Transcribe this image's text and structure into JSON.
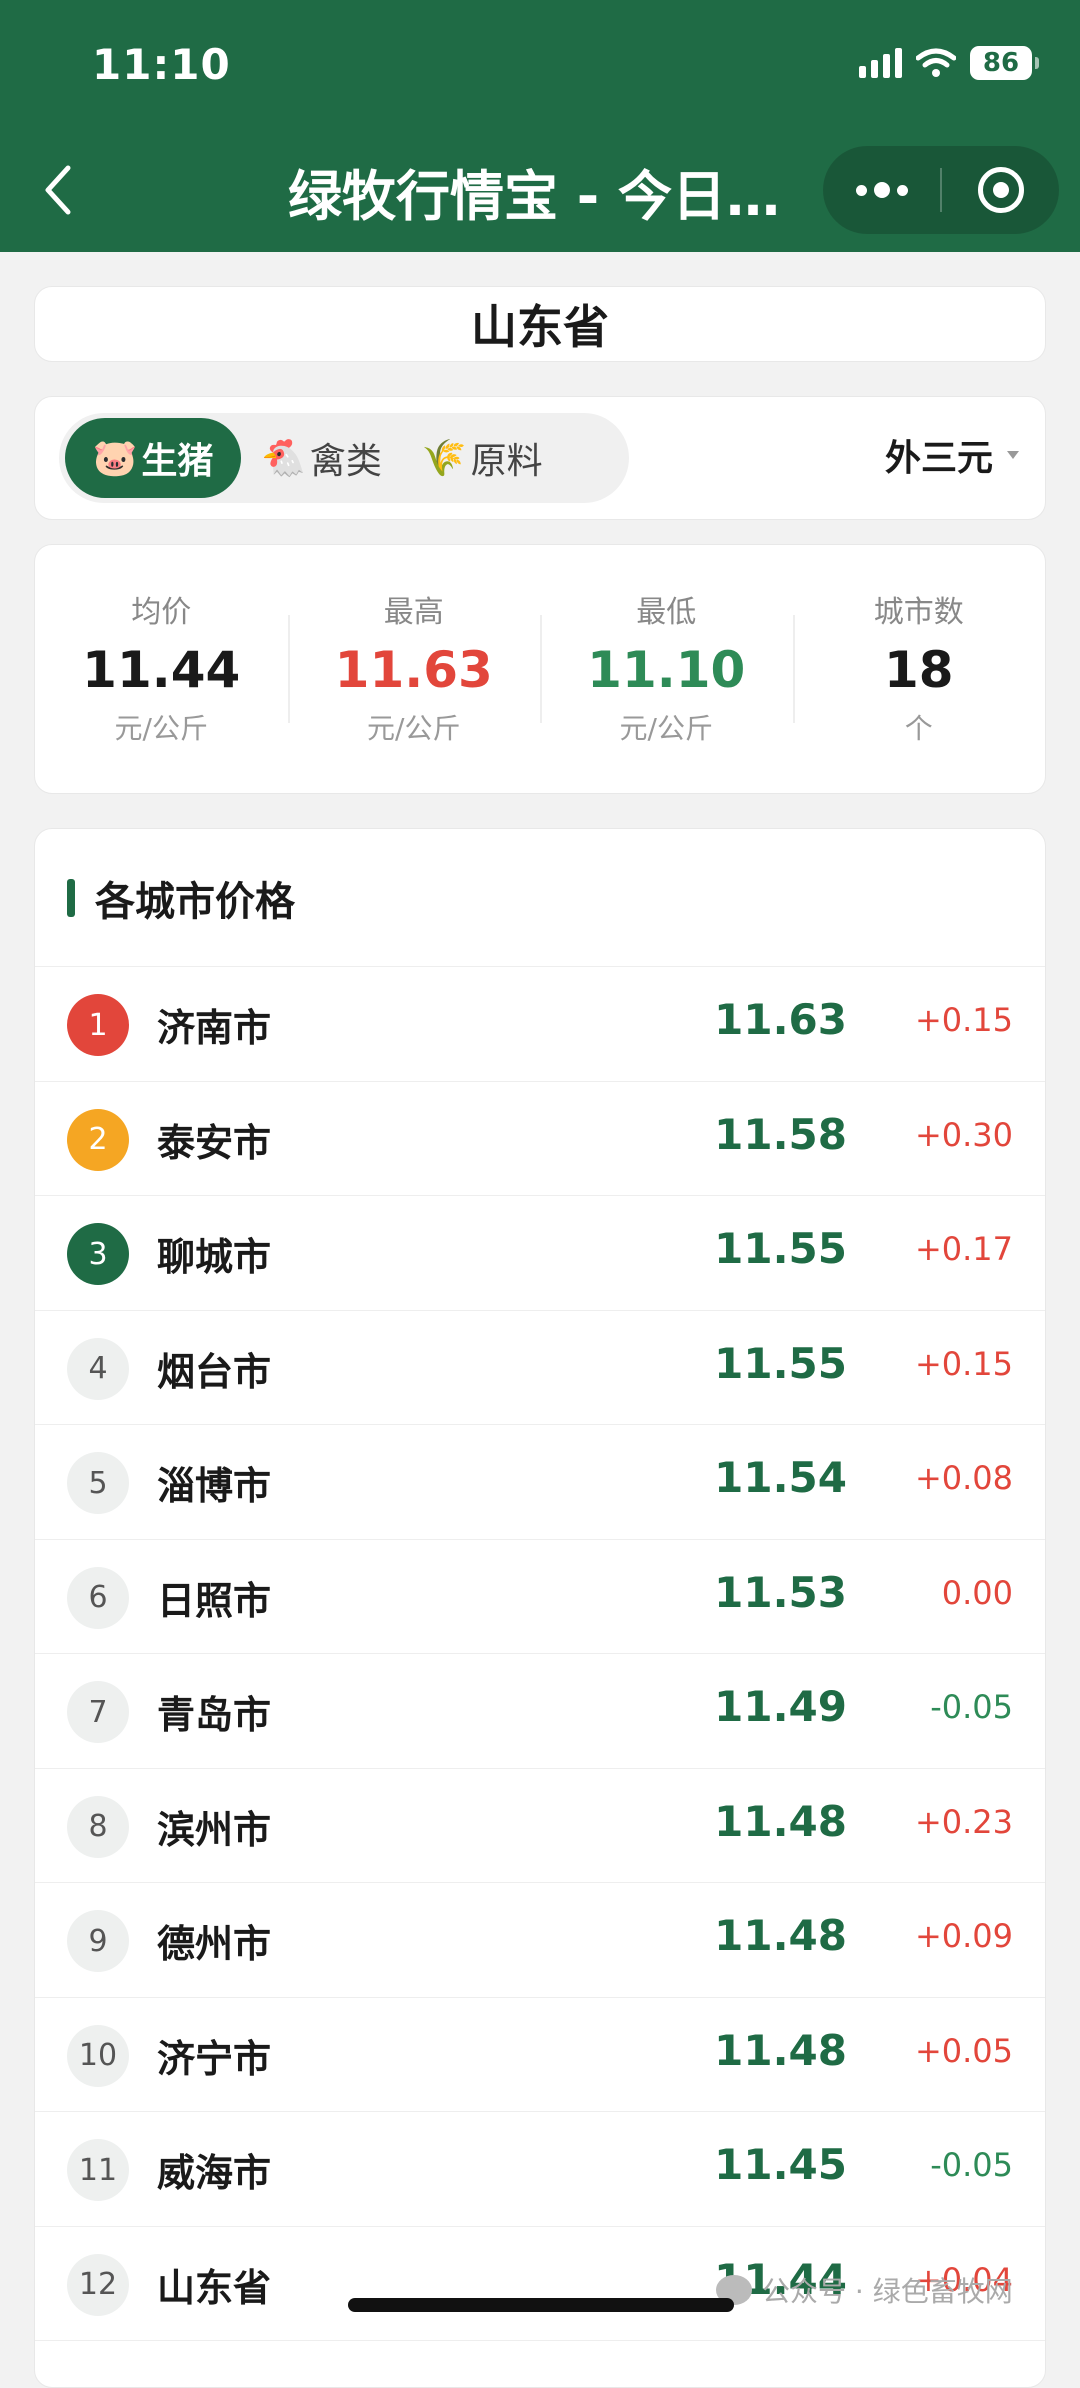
{
  "status_bar": {
    "time": "11:10",
    "battery": "86"
  },
  "nav": {
    "title": "绿牧行情宝 - 今日…"
  },
  "province": "山东省",
  "tabs": [
    {
      "emoji": "🐷",
      "label": "生猪"
    },
    {
      "emoji": "🐔",
      "label": "禽类"
    },
    {
      "emoji": "🌾",
      "label": "原料"
    }
  ],
  "type_select": "外三元",
  "stats": [
    {
      "label": "均价",
      "value": "11.44",
      "unit": "元/公斤",
      "color": "#1a1a1a"
    },
    {
      "label": "最高",
      "value": "11.63",
      "unit": "元/公斤",
      "color": "#e2463b"
    },
    {
      "label": "最低",
      "value": "11.10",
      "unit": "元/公斤",
      "color": "#2e8b57"
    },
    {
      "label": "城市数",
      "value": "18",
      "unit": "个",
      "color": "#1a1a1a"
    }
  ],
  "list_title": "各城市价格",
  "rows": [
    {
      "rank": "1",
      "city": "济南市",
      "price": "11.63",
      "change": "+0.15"
    },
    {
      "rank": "2",
      "city": "泰安市",
      "price": "11.58",
      "change": "+0.30"
    },
    {
      "rank": "3",
      "city": "聊城市",
      "price": "11.55",
      "change": "+0.17"
    },
    {
      "rank": "4",
      "city": "烟台市",
      "price": "11.55",
      "change": "+0.15"
    },
    {
      "rank": "5",
      "city": "淄博市",
      "price": "11.54",
      "change": "+0.08"
    },
    {
      "rank": "6",
      "city": "日照市",
      "price": "11.53",
      "change": "0.00"
    },
    {
      "rank": "7",
      "city": "青岛市",
      "price": "11.49",
      "change": "-0.05"
    },
    {
      "rank": "8",
      "city": "滨州市",
      "price": "11.48",
      "change": "+0.23"
    },
    {
      "rank": "9",
      "city": "德州市",
      "price": "11.48",
      "change": "+0.09"
    },
    {
      "rank": "10",
      "city": "济宁市",
      "price": "11.48",
      "change": "+0.05"
    },
    {
      "rank": "11",
      "city": "威海市",
      "price": "11.45",
      "change": "-0.05"
    },
    {
      "rank": "12",
      "city": "山东省",
      "price": "11.44",
      "change": "+0.04"
    }
  ],
  "colors": {
    "brand": "#1f6b45",
    "up": "#e2463b",
    "down": "#2e8b57"
  },
  "watermark": "公众号 · 绿色畜牧网"
}
